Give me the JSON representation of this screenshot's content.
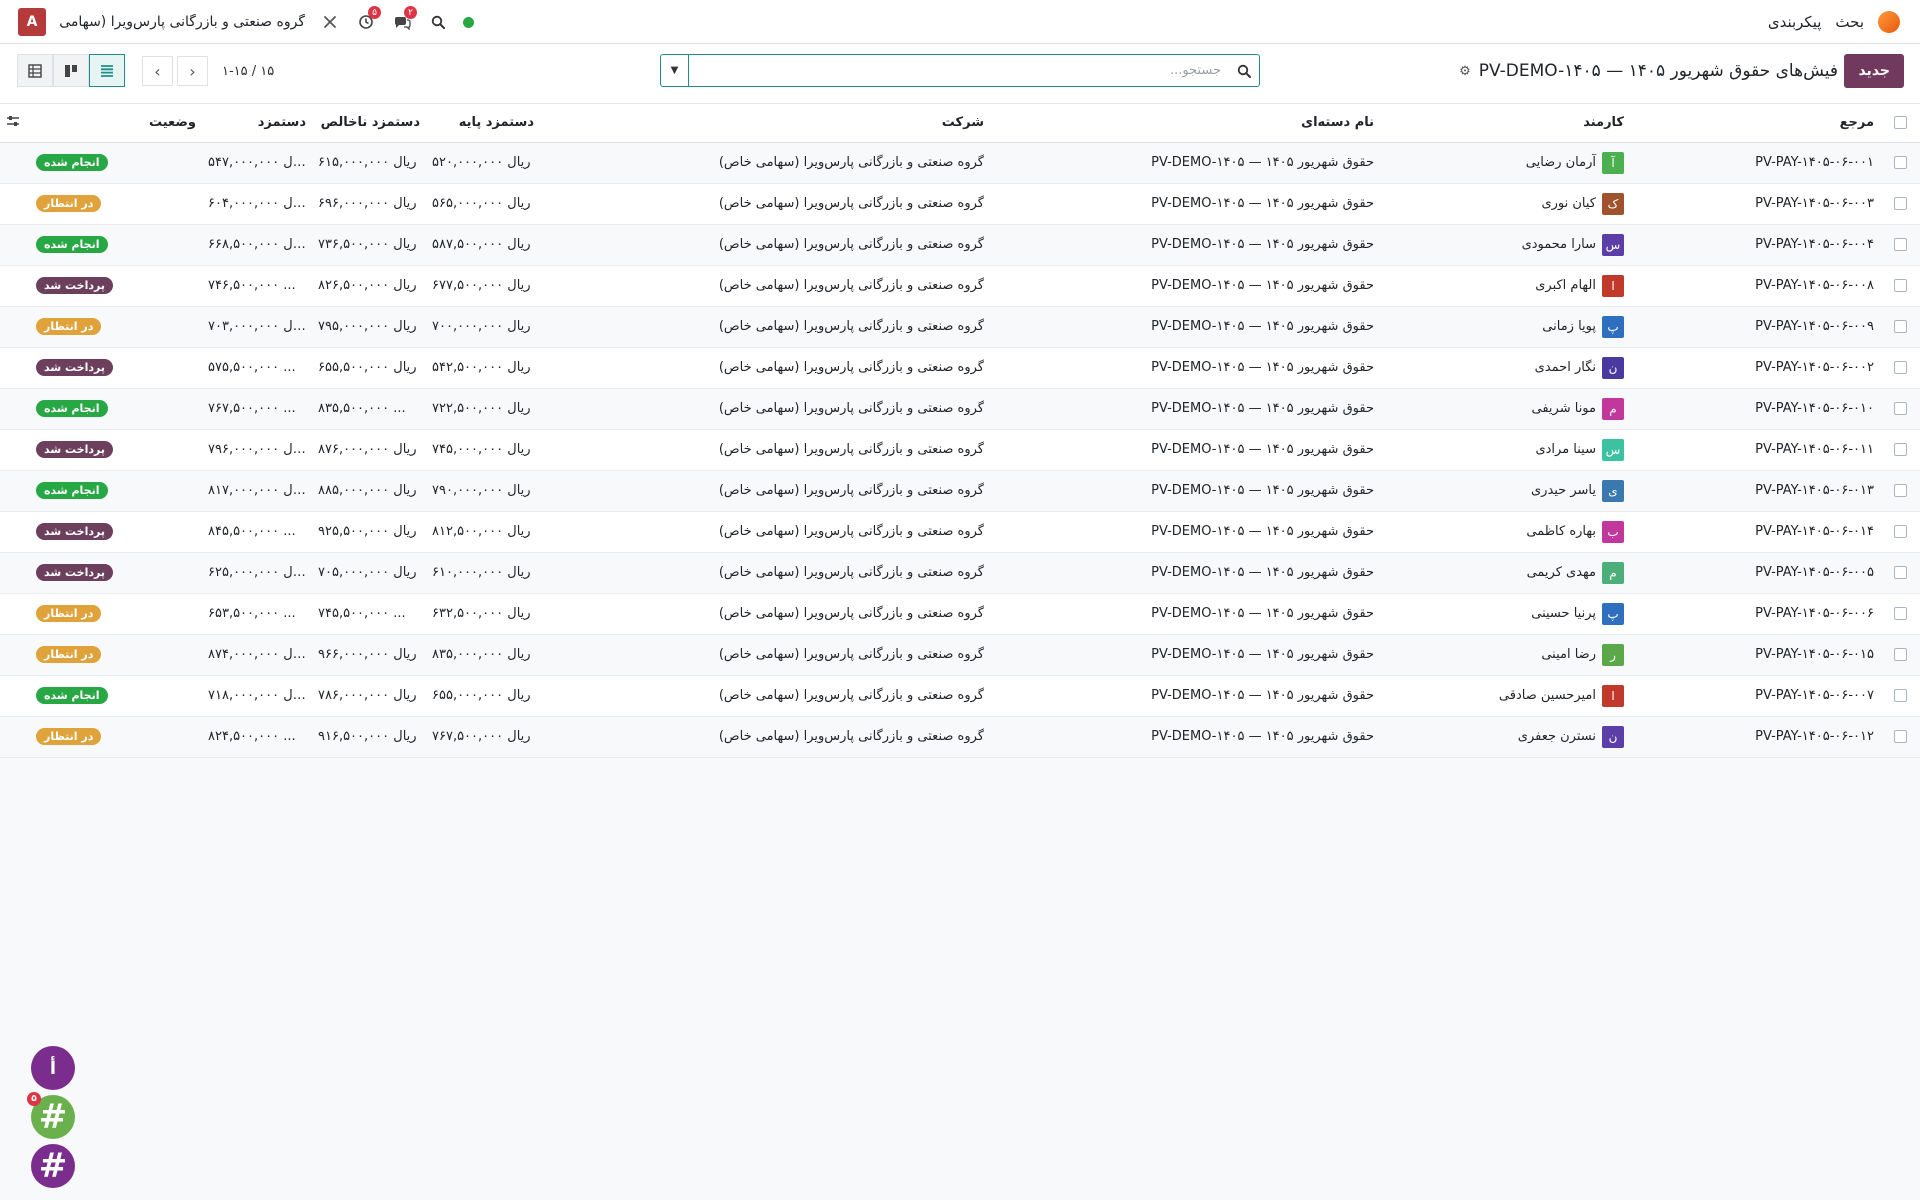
{
  "navbar": {
    "brand": "بحث",
    "menu_config": "پیکربندی",
    "company": "گروه صنعتی و بازرگانی پارس‌ویرا (سهامی ...",
    "user_initial": "A",
    "activity_badge": "۵",
    "messages_badge": "۲"
  },
  "control_panel": {
    "new_button": "جدید",
    "title": "فیش‌های حقوق شهریور ۱۴۰۵ — PV-DEMO-۱۴۰۵",
    "search_placeholder": "جستجو...",
    "pager_value": "۱-۱۵ / ۱۵"
  },
  "columns": {
    "ref": "مرجع",
    "employee": "کارمند",
    "batch": "نام دسته‌ای",
    "company": "شرکت",
    "base": "دستمزد پایه",
    "gross": "دستمزد ناخالص",
    "net": "دستمزد",
    "status": "وضعیت"
  },
  "colors": {
    "primary": "#71395e",
    "accent": "#1f8e8a",
    "done": "#28a745",
    "waiting": "#e0a23a",
    "paid": "#6c3f5c"
  },
  "rows": [
    {
      "ref": "PV-PAY-۱۴۰۵-۰۶-۰۰۱",
      "initial": "آ",
      "avatar_color": "#4caf50",
      "employee": "آرمان رضایی",
      "batch": "حقوق شهریور ۱۴۰۵ — PV-DEMO-۱۴۰۵",
      "company": "گروه صنعتی و بازرگانی پارس‌ویرا (سهامی خاص)",
      "base": "۵۲۰,۰۰۰,۰۰۰ ریال",
      "gross": "۶۱۵,۰۰۰,۰۰۰ ریال",
      "net": "۵۴۷,۰۰۰,۰۰۰ ریال",
      "status": "انجام شده",
      "status_color": "#28a745"
    },
    {
      "ref": "PV-PAY-۱۴۰۵-۰۶-۰۰۳",
      "initial": "ک",
      "avatar_color": "#a0522d",
      "employee": "کیان نوری",
      "batch": "حقوق شهریور ۱۴۰۵ — PV-DEMO-۱۴۰۵",
      "company": "گروه صنعتی و بازرگانی پارس‌ویرا (سهامی خاص)",
      "base": "۵۶۵,۰۰۰,۰۰۰ ریال",
      "gross": "۶۹۶,۰۰۰,۰۰۰ ریال",
      "net": "۶۰۴,۰۰۰,۰۰۰ ریال",
      "status": "در انتظار",
      "status_color": "#e0a23a"
    },
    {
      "ref": "PV-PAY-۱۴۰۵-۰۶-۰۰۴",
      "initial": "س",
      "avatar_color": "#5b3ea8",
      "employee": "سارا محمودی",
      "batch": "حقوق شهریور ۱۴۰۵ — PV-DEMO-۱۴۰۵",
      "company": "گروه صنعتی و بازرگانی پارس‌ویرا (سهامی خاص)",
      "base": "۵۸۷,۵۰۰,۰۰۰ ریال",
      "gross": "۷۳۶,۵۰۰,۰۰۰ ریال",
      "net": "۶۶۸,۵۰۰,۰۰۰ ریال",
      "status": "انجام شده",
      "status_color": "#28a745"
    },
    {
      "ref": "PV-PAY-۱۴۰۵-۰۶-۰۰۸",
      "initial": "ا",
      "avatar_color": "#c0392b",
      "employee": "الهام اکبری",
      "batch": "حقوق شهریور ۱۴۰۵ — PV-DEMO-۱۴۰۵",
      "company": "گروه صنعتی و بازرگانی پارس‌ویرا (سهامی خاص)",
      "base": "۶۷۷,۵۰۰,۰۰۰ ریال",
      "gross": "۸۲۶,۵۰۰,۰۰۰ ریال",
      "net": "۷۴۶,۵۰۰,۰۰۰ ...",
      "status": "پرداخت شد",
      "status_color": "#6c3f5c"
    },
    {
      "ref": "PV-PAY-۱۴۰۵-۰۶-۰۰۹",
      "initial": "پ",
      "avatar_color": "#2f6fbf",
      "employee": "پویا زمانی",
      "batch": "حقوق شهریور ۱۴۰۵ — PV-DEMO-۱۴۰۵",
      "company": "گروه صنعتی و بازرگانی پارس‌ویرا (سهامی خاص)",
      "base": "۷۰۰,۰۰۰,۰۰۰ ریال",
      "gross": "۷۹۵,۰۰۰,۰۰۰ ریال",
      "net": "۷۰۳,۰۰۰,۰۰۰ ریال",
      "status": "در انتظار",
      "status_color": "#e0a23a"
    },
    {
      "ref": "PV-PAY-۱۴۰۵-۰۶-۰۰۲",
      "initial": "ن",
      "avatar_color": "#4a3aa0",
      "employee": "نگار احمدی",
      "batch": "حقوق شهریور ۱۴۰۵ — PV-DEMO-۱۴۰۵",
      "company": "گروه صنعتی و بازرگانی پارس‌ویرا (سهامی خاص)",
      "base": "۵۴۲,۵۰۰,۰۰۰ ریال",
      "gross": "۶۵۵,۵۰۰,۰۰۰ ریال",
      "net": "۵۷۵,۵۰۰,۰۰۰ ...",
      "status": "پرداخت شد",
      "status_color": "#6c3f5c"
    },
    {
      "ref": "PV-PAY-۱۴۰۵-۰۶-۰۱۰",
      "initial": "م",
      "avatar_color": "#c2379b",
      "employee": "مونا شریفی",
      "batch": "حقوق شهریور ۱۴۰۵ — PV-DEMO-۱۴۰۵",
      "company": "گروه صنعتی و بازرگانی پارس‌ویرا (سهامی خاص)",
      "base": "۷۲۲,۵۰۰,۰۰۰ ریال",
      "gross": "۸۳۵,۵۰۰,۰۰۰ ...",
      "net": "۷۶۷,۵۰۰,۰۰۰ ...",
      "status": "انجام شده",
      "status_color": "#28a745"
    },
    {
      "ref": "PV-PAY-۱۴۰۵-۰۶-۰۱۱",
      "initial": "س",
      "avatar_color": "#3cc2a0",
      "employee": "سینا مرادی",
      "batch": "حقوق شهریور ۱۴۰۵ — PV-DEMO-۱۴۰۵",
      "company": "گروه صنعتی و بازرگانی پارس‌ویرا (سهامی خاص)",
      "base": "۷۴۵,۰۰۰,۰۰۰ ریال",
      "gross": "۸۷۶,۰۰۰,۰۰۰ ریال",
      "net": "۷۹۶,۰۰۰,۰۰۰ ریال",
      "status": "پرداخت شد",
      "status_color": "#6c3f5c"
    },
    {
      "ref": "PV-PAY-۱۴۰۵-۰۶-۰۱۳",
      "initial": "ی",
      "avatar_color": "#3a78b0",
      "employee": "یاسر حیدری",
      "batch": "حقوق شهریور ۱۴۰۵ — PV-DEMO-۱۴۰۵",
      "company": "گروه صنعتی و بازرگانی پارس‌ویرا (سهامی خاص)",
      "base": "۷۹۰,۰۰۰,۰۰۰ ریال",
      "gross": "۸۸۵,۰۰۰,۰۰۰ ریال",
      "net": "۸۱۷,۰۰۰,۰۰۰ ریال",
      "status": "انجام شده",
      "status_color": "#28a745"
    },
    {
      "ref": "PV-PAY-۱۴۰۵-۰۶-۰۱۴",
      "initial": "ب",
      "avatar_color": "#c2379b",
      "employee": "بهاره کاظمی",
      "batch": "حقوق شهریور ۱۴۰۵ — PV-DEMO-۱۴۰۵",
      "company": "گروه صنعتی و بازرگانی پارس‌ویرا (سهامی خاص)",
      "base": "۸۱۲,۵۰۰,۰۰۰ ریال",
      "gross": "۹۲۵,۵۰۰,۰۰۰ ریال",
      "net": "۸۴۵,۵۰۰,۰۰۰ ...",
      "status": "پرداخت شد",
      "status_color": "#6c3f5c"
    },
    {
      "ref": "PV-PAY-۱۴۰۵-۰۶-۰۰۵",
      "initial": "م",
      "avatar_color": "#4caf7a",
      "employee": "مهدی کریمی",
      "batch": "حقوق شهریور ۱۴۰۵ — PV-DEMO-۱۴۰۵",
      "company": "گروه صنعتی و بازرگانی پارس‌ویرا (سهامی خاص)",
      "base": "۶۱۰,۰۰۰,۰۰۰ ریال",
      "gross": "۷۰۵,۰۰۰,۰۰۰ ریال",
      "net": "۶۲۵,۰۰۰,۰۰۰ ریال",
      "status": "پرداخت شد",
      "status_color": "#6c3f5c"
    },
    {
      "ref": "PV-PAY-۱۴۰۵-۰۶-۰۰۶",
      "initial": "پ",
      "avatar_color": "#2f6fbf",
      "employee": "پرنیا حسینی",
      "batch": "حقوق شهریور ۱۴۰۵ — PV-DEMO-۱۴۰۵",
      "company": "گروه صنعتی و بازرگانی پارس‌ویرا (سهامی خاص)",
      "base": "۶۳۲,۵۰۰,۰۰۰ ریال",
      "gross": "۷۴۵,۵۰۰,۰۰۰ ...",
      "net": "۶۵۳,۵۰۰,۰۰۰ ...",
      "status": "در انتظار",
      "status_color": "#e0a23a"
    },
    {
      "ref": "PV-PAY-۱۴۰۵-۰۶-۰۱۵",
      "initial": "ر",
      "avatar_color": "#5aa84a",
      "employee": "رضا امینی",
      "batch": "حقوق شهریور ۱۴۰۵ — PV-DEMO-۱۴۰۵",
      "company": "گروه صنعتی و بازرگانی پارس‌ویرا (سهامی خاص)",
      "base": "۸۳۵,۰۰۰,۰۰۰ ریال",
      "gross": "۹۶۶,۰۰۰,۰۰۰ ریال",
      "net": "۸۷۴,۰۰۰,۰۰۰ ریال",
      "status": "در انتظار",
      "status_color": "#e0a23a"
    },
    {
      "ref": "PV-PAY-۱۴۰۵-۰۶-۰۰۷",
      "initial": "ا",
      "avatar_color": "#c0392b",
      "employee": "امیرحسین صادقی",
      "batch": "حقوق شهریور ۱۴۰۵ — PV-DEMO-۱۴۰۵",
      "company": "گروه صنعتی و بازرگانی پارس‌ویرا (سهامی خاص)",
      "base": "۶۵۵,۰۰۰,۰۰۰ ریال",
      "gross": "۷۸۶,۰۰۰,۰۰۰ ریال",
      "net": "۷۱۸,۰۰۰,۰۰۰ ریال",
      "status": "انجام شده",
      "status_color": "#28a745"
    },
    {
      "ref": "PV-PAY-۱۴۰۵-۰۶-۰۱۲",
      "initial": "ن",
      "avatar_color": "#5b3ea8",
      "employee": "نسترن جعفری",
      "batch": "حقوق شهریور ۱۴۰۵ — PV-DEMO-۱۴۰۵",
      "company": "گروه صنعتی و بازرگانی پارس‌ویرا (سهامی خاص)",
      "base": "۷۶۷,۵۰۰,۰۰۰ ریال",
      "gross": "۹۱۶,۵۰۰,۰۰۰ ریال",
      "net": "۸۲۴,۵۰۰,۰۰۰ ...",
      "status": "در انتظار",
      "status_color": "#e0a23a"
    }
  ],
  "chat_bubbles": [
    {
      "label": "أ",
      "color": "#7b2d8e",
      "badge": ""
    },
    {
      "label": "#",
      "color": "#6ab04c",
      "badge": "۵"
    },
    {
      "label": "#",
      "color": "#7b2d8e",
      "badge": ""
    }
  ]
}
